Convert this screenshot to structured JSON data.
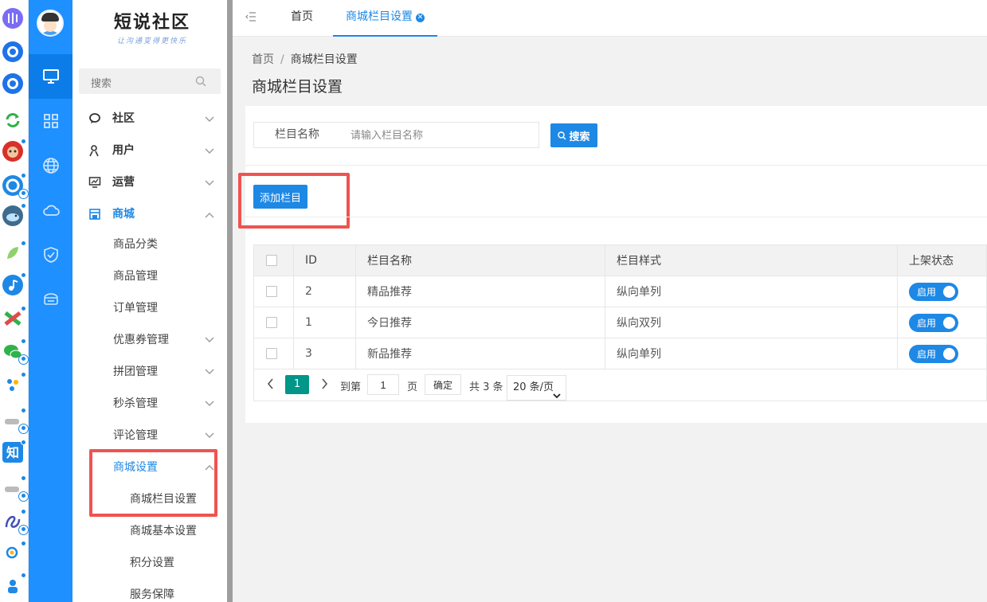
{
  "sidebar": {
    "logo_title": "短说社区",
    "logo_subtitle": "让沟通变得更快乐",
    "search_placeholder": "搜索",
    "menu": [
      {
        "label": "社区",
        "icon": "chat-icon"
      },
      {
        "label": "用户",
        "icon": "user-icon"
      },
      {
        "label": "运营",
        "icon": "monitor-chart-icon"
      },
      {
        "label": "商城",
        "icon": "store-icon"
      }
    ],
    "shop_items": [
      "商品分类",
      "商品管理",
      "订单管理",
      "优惠券管理",
      "拼团管理",
      "秒杀管理",
      "评论管理",
      "商城设置"
    ],
    "shop_settings_items": [
      "商城栏目设置",
      "商城基本设置",
      "积分设置",
      "服务保障"
    ]
  },
  "tabs": {
    "home": "首页",
    "current": "商城栏目设置"
  },
  "breadcrumb": {
    "home": "首页",
    "separator": "/",
    "current": "商城栏目设置"
  },
  "page_title": "商城栏目设置",
  "filter": {
    "label": "栏目名称",
    "placeholder": "请输入栏目名称",
    "search_button": "搜索"
  },
  "add_button": "添加栏目",
  "table": {
    "headers": [
      "ID",
      "栏目名称",
      "栏目样式",
      "上架状态"
    ],
    "rows": [
      {
        "id": "2",
        "name": "精品推荐",
        "style": "纵向单列",
        "status": "启用"
      },
      {
        "id": "1",
        "name": "今日推荐",
        "style": "纵向双列",
        "status": "启用"
      },
      {
        "id": "3",
        "name": "新品推荐",
        "style": "纵向单列",
        "status": "启用"
      }
    ]
  },
  "pagination": {
    "current_page": "1",
    "goto_label": "到第",
    "goto_value": "1",
    "page_unit": "页",
    "confirm": "确定",
    "total": "共 3 条",
    "page_size": "20 条/页"
  },
  "colors": {
    "primary": "#1e88e5",
    "rail": "#1e90ff",
    "pager_active": "#009688",
    "highlight": "#ef5350"
  }
}
